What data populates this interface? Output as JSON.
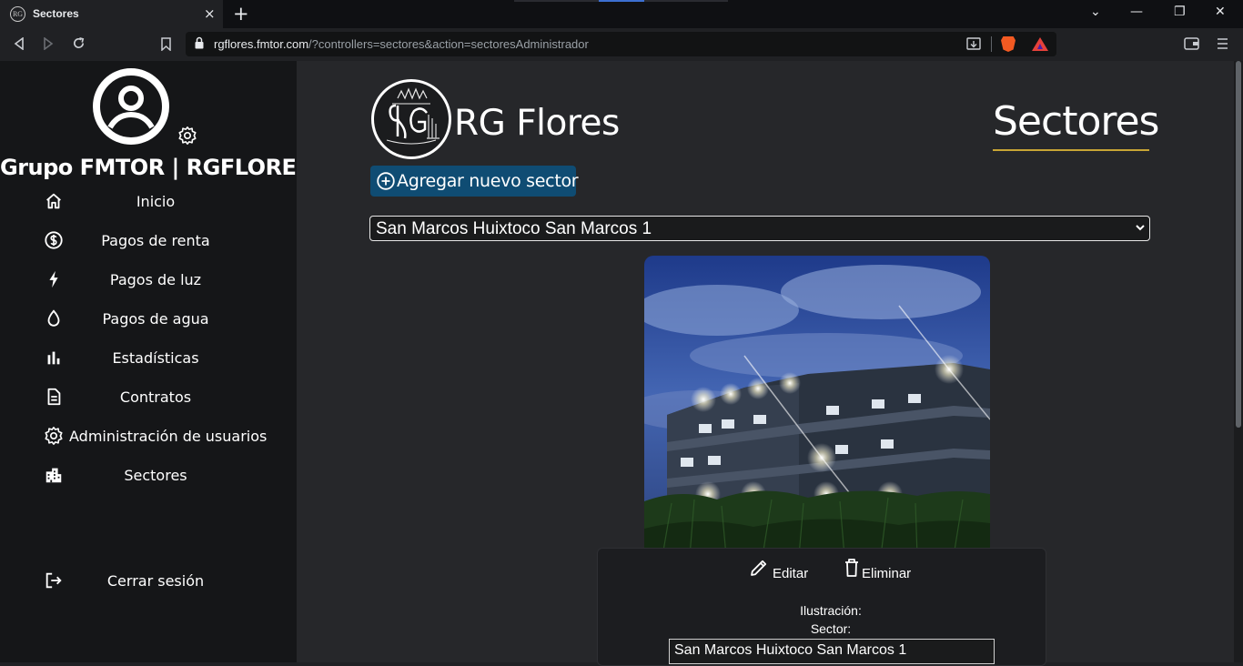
{
  "browser": {
    "tab_title": "Sectores",
    "tab_close": "×",
    "new_tab": "+",
    "favicon_text": "RG",
    "url_domain": "rgflores.fmtor.com",
    "url_path": "/?controllers=sectores&action=sectoresAdministrador",
    "win_minimize": "—",
    "win_restore": "❐",
    "win_close": "✕",
    "chevron": "⌄"
  },
  "sidebar": {
    "org_name": "Grupo FMTOR | RGFLORES",
    "items": [
      {
        "label": "Inicio",
        "icon": "home-icon"
      },
      {
        "label": "Pagos de renta",
        "icon": "dollar-circle-icon"
      },
      {
        "label": "Pagos de luz",
        "icon": "lightning-icon"
      },
      {
        "label": "Pagos de agua",
        "icon": "water-drop-icon"
      },
      {
        "label": "Estadísticas",
        "icon": "bar-chart-icon"
      },
      {
        "label": "Contratos",
        "icon": "document-icon"
      },
      {
        "label": "Administración de usuarios",
        "icon": "gear-icon"
      },
      {
        "label": "Sectores",
        "icon": "buildings-icon"
      }
    ],
    "logout_label": "Cerrar sesión"
  },
  "header": {
    "brand": "RG Flores",
    "page_title": "Sectores",
    "accent_color": "#c8a535"
  },
  "main": {
    "add_button_label": "Agregar nuevo sector",
    "selected_sector": "San Marcos Huixtoco San Marcos 1",
    "card": {
      "edit_label": "Editar",
      "delete_label": "Eliminar",
      "illustration_label": "Ilustración:",
      "sector_label": "Sector:",
      "sector_value": "San Marcos Huixtoco San Marcos 1"
    }
  }
}
